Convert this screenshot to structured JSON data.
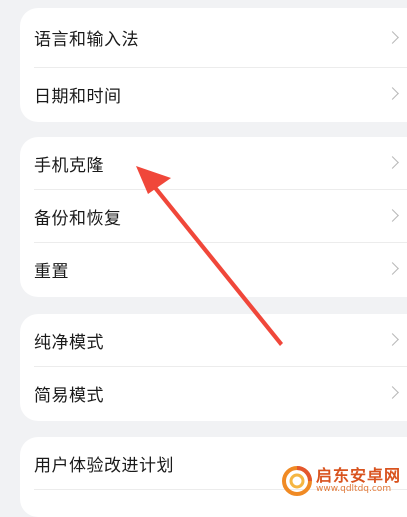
{
  "groups": [
    {
      "items": [
        {
          "label": "语言和输入法"
        },
        {
          "label": "日期和时间"
        }
      ]
    },
    {
      "items": [
        {
          "label": "手机克隆"
        },
        {
          "label": "备份和恢复"
        },
        {
          "label": "重置"
        }
      ]
    },
    {
      "items": [
        {
          "label": "纯净模式"
        },
        {
          "label": "简易模式"
        }
      ]
    },
    {
      "items": [
        {
          "label": "用户体验改进计划"
        }
      ]
    }
  ],
  "watermark": {
    "title": "启东安卓网",
    "url": "www.qdltdq.com"
  },
  "colors": {
    "arrow": "#f0473a",
    "background": "#f1f2f4",
    "card": "#ffffff",
    "watermark": "#d9531e"
  },
  "icons": {
    "row_chevron": "chevron-right-icon"
  }
}
